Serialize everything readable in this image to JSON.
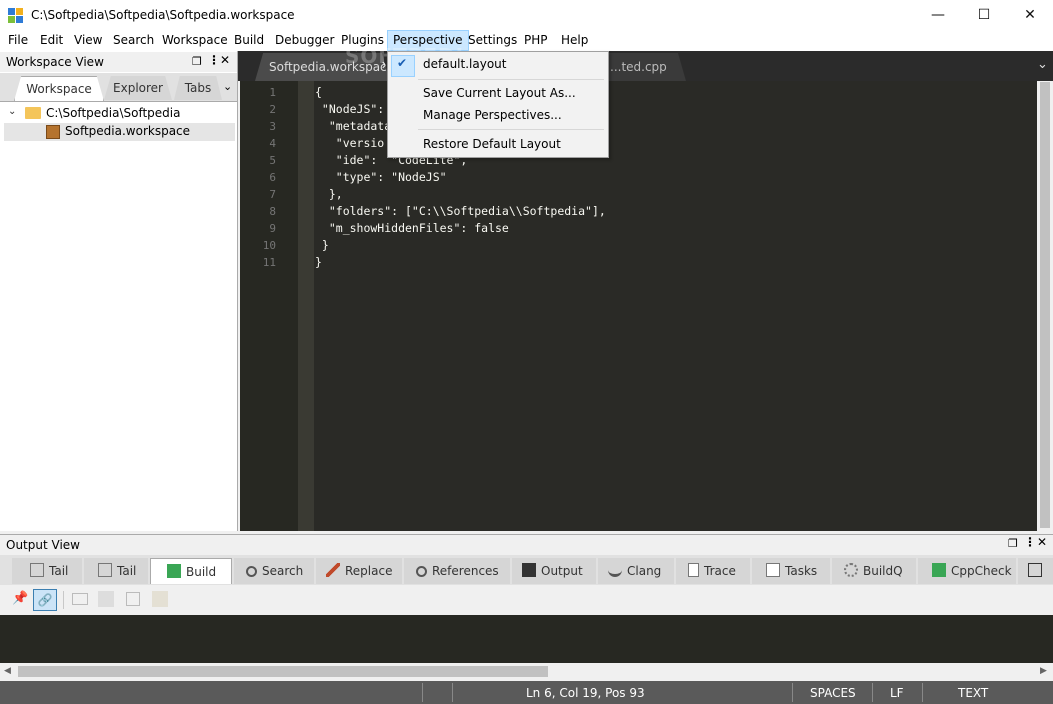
{
  "window": {
    "title": "C:\\Softpedia\\Softpedia\\Softpedia.workspace",
    "controls": {
      "minimize": "—",
      "maximize": "☐",
      "close": "✕"
    }
  },
  "menu": [
    "File",
    "Edit",
    "View",
    "Search",
    "Workspace",
    "Build",
    "Debugger",
    "Plugins",
    "Perspective",
    "Settings",
    "PHP",
    "Help"
  ],
  "perspective_menu": {
    "items": [
      "default.layout",
      "Save Current Layout As...",
      "Manage Perspectives...",
      "Restore Default Layout"
    ],
    "checked": "default.layout"
  },
  "workspace_view": {
    "title": "Workspace View",
    "tabs": [
      "Workspace",
      "Explorer",
      "Tabs"
    ],
    "active_tab": "Workspace",
    "tree": {
      "folder": "C:\\Softpedia\\Softpedia",
      "file": "Softpedia.workspace"
    }
  },
  "editor": {
    "tabs": [
      "Softpedia.workspace",
      "...ted.cpp"
    ],
    "active_tab": "Softpedia.workspace",
    "line_numbers": [
      "1",
      "2",
      "3",
      "4",
      "5",
      "6",
      "7",
      "8",
      "9",
      "10",
      "11"
    ],
    "lines": [
      "{",
      " \"NodeJS\":",
      "  \"metadata",
      "   \"versio",
      "   \"ide\":  \"CodeLite\",",
      "   \"type\": \"NodeJS\"",
      "  },",
      "  \"folders\": [\"C:\\\\Softpedia\\\\Softpedia\"],",
      "  \"m_showHiddenFiles\": false",
      " }",
      "}"
    ],
    "background": "#272822"
  },
  "output_view": {
    "title": "Output View",
    "tabs": [
      "Tail",
      "Tail",
      "Build",
      "Search",
      "Replace",
      "References",
      "Output",
      "Clang",
      "Trace",
      "Tasks",
      "BuildQ",
      "CppCheck"
    ],
    "active_tab": "Build"
  },
  "statusbar": {
    "position": "Ln 6, Col 19, Pos 93",
    "indent": "SPACES",
    "eol": "LF",
    "mode": "TEXT"
  },
  "watermark": "SOFTPEDIA"
}
